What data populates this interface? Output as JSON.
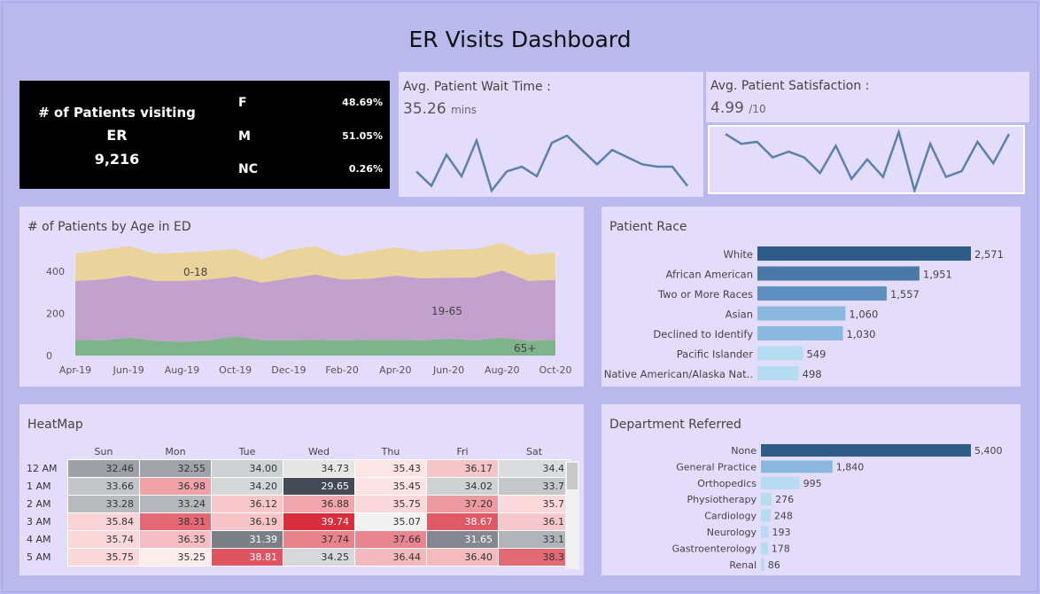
{
  "title": "ER Visits Dashboard",
  "kpi": {
    "label1": "# of Patients visiting",
    "label2": "ER",
    "total": "9,216",
    "genders": [
      {
        "g": "F",
        "p": "48.69%"
      },
      {
        "g": "M",
        "p": "51.05%"
      },
      {
        "g": "NC",
        "p": "0.26%"
      }
    ]
  },
  "wait": {
    "title": "Avg. Patient Wait Time :",
    "value": "35.26",
    "unit": "mins"
  },
  "satisfaction": {
    "title": "Avg. Patient Satisfaction :",
    "value": "4.99",
    "unit": "/10"
  },
  "age": {
    "title": "# of Patients by Age in ED",
    "labels": {
      "a": "0-18",
      "b": "19-65",
      "c": "65+"
    }
  },
  "race": {
    "title": "Patient Race"
  },
  "heatmap": {
    "title": "HeatMap"
  },
  "dept": {
    "title": "Department Referred"
  },
  "colors": {
    "bg": "#b9b8f0",
    "panel": "#e4dcfb",
    "line": "#5a82a8",
    "dark_bar": "#2e5b87",
    "light_bar": "#b5dcf0"
  },
  "chart_data": [
    {
      "type": "line",
      "name": "wait_sparkline",
      "values": [
        38,
        32,
        45,
        36,
        51,
        30,
        38,
        40,
        36,
        50,
        53,
        47,
        41,
        47,
        44,
        41,
        40,
        40,
        32
      ]
    },
    {
      "type": "line",
      "name": "satisfaction_sparkline",
      "values": [
        6.2,
        5.7,
        5.8,
        5.0,
        5.3,
        5.0,
        4.2,
        5.6,
        3.9,
        4.9,
        4.0,
        6.3,
        3.3,
        5.7,
        4.0,
        4.3,
        5.8,
        4.7,
        6.2
      ]
    },
    {
      "type": "area",
      "name": "age",
      "x": [
        "Apr-19",
        "May-19",
        "Jun-19",
        "Jul-19",
        "Aug-19",
        "Sep-19",
        "Oct-19",
        "Nov-19",
        "Dec-19",
        "Jan-20",
        "Feb-20",
        "Mar-20",
        "Apr-20",
        "May-20",
        "Jun-20",
        "Jul-20",
        "Aug-20",
        "Sep-20",
        "Oct-20"
      ],
      "x_ticks": [
        "Apr-19",
        "Jun-19",
        "Aug-19",
        "Oct-19",
        "Dec-19",
        "Feb-20",
        "Apr-20",
        "Jun-20",
        "Aug-20",
        "Oct-20"
      ],
      "y_ticks": [
        0,
        200,
        400
      ],
      "ylim": [
        0,
        540
      ],
      "series": [
        {
          "name": "65+",
          "values": [
            75,
            72,
            85,
            70,
            65,
            72,
            92,
            72,
            72,
            75,
            72,
            75,
            75,
            72,
            80,
            72,
            85,
            70,
            75
          ],
          "color": "#7fb48a"
        },
        {
          "name": "19-65",
          "values": [
            280,
            290,
            295,
            285,
            290,
            290,
            285,
            275,
            295,
            310,
            290,
            290,
            305,
            295,
            290,
            300,
            320,
            285,
            285
          ],
          "color": "#c2a1cc"
        },
        {
          "name": "0-18",
          "values": [
            130,
            140,
            140,
            130,
            135,
            135,
            130,
            110,
            135,
            135,
            110,
            130,
            135,
            125,
            135,
            135,
            130,
            125,
            130
          ],
          "color": "#ead49c"
        }
      ]
    },
    {
      "type": "bar",
      "name": "race",
      "orientation": "horizontal",
      "categories": [
        "White",
        "African American",
        "Two or More Races",
        "Asian",
        "Declined to Identify",
        "Pacific Islander",
        "Native American/Alaska Nat.."
      ],
      "values": [
        2571,
        1951,
        1557,
        1060,
        1030,
        549,
        498
      ],
      "labels": [
        "2,571",
        "1,951",
        "1,557",
        "1,060",
        "1,030",
        "549",
        "498"
      ],
      "colors": [
        "#2e5b87",
        "#4a79a8",
        "#5f8fc0",
        "#8ab8de",
        "#8ab8de",
        "#b5dcf0",
        "#b5dcf0"
      ]
    },
    {
      "type": "heatmap",
      "name": "heatmap",
      "columns": [
        "Sun",
        "Mon",
        "Tue",
        "Wed",
        "Thu",
        "Fri",
        "Sat"
      ],
      "rows": [
        "12 AM",
        "1 AM",
        "2 AM",
        "3 AM",
        "4 AM",
        "5 AM"
      ],
      "values": [
        [
          "32.46",
          "32.55",
          "34.00",
          "34.73",
          "35.43",
          "36.17",
          "34.4"
        ],
        [
          "33.66",
          "36.98",
          "34.20",
          "29.65",
          "35.45",
          "34.02",
          "33.7"
        ],
        [
          "33.28",
          "33.24",
          "36.12",
          "36.88",
          "35.75",
          "37.20",
          "35.7"
        ],
        [
          "35.84",
          "38.31",
          "36.19",
          "39.74",
          "35.07",
          "38.67",
          "36.1"
        ],
        [
          "35.74",
          "36.35",
          "31.39",
          "37.74",
          "37.66",
          "31.65",
          "33.1"
        ],
        [
          "35.75",
          "35.25",
          "38.81",
          "34.25",
          "36.44",
          "36.40",
          "38.3"
        ]
      ]
    },
    {
      "type": "bar",
      "name": "dept",
      "orientation": "horizontal",
      "categories": [
        "None",
        "General Practice",
        "Orthopedics",
        "Physiotherapy",
        "Cardiology",
        "Neurology",
        "Gastroenterology",
        "Renal"
      ],
      "values": [
        5400,
        1840,
        995,
        276,
        248,
        193,
        178,
        86
      ],
      "labels": [
        "5,400",
        "1,840",
        "995",
        "276",
        "248",
        "193",
        "178",
        "86"
      ],
      "colors": [
        "#2e5b87",
        "#8ab8de",
        "#b5dcf0",
        "#b5dcf0",
        "#b5dcf0",
        "#b5dcf0",
        "#b5dcf0",
        "#b5dcf0"
      ]
    }
  ]
}
